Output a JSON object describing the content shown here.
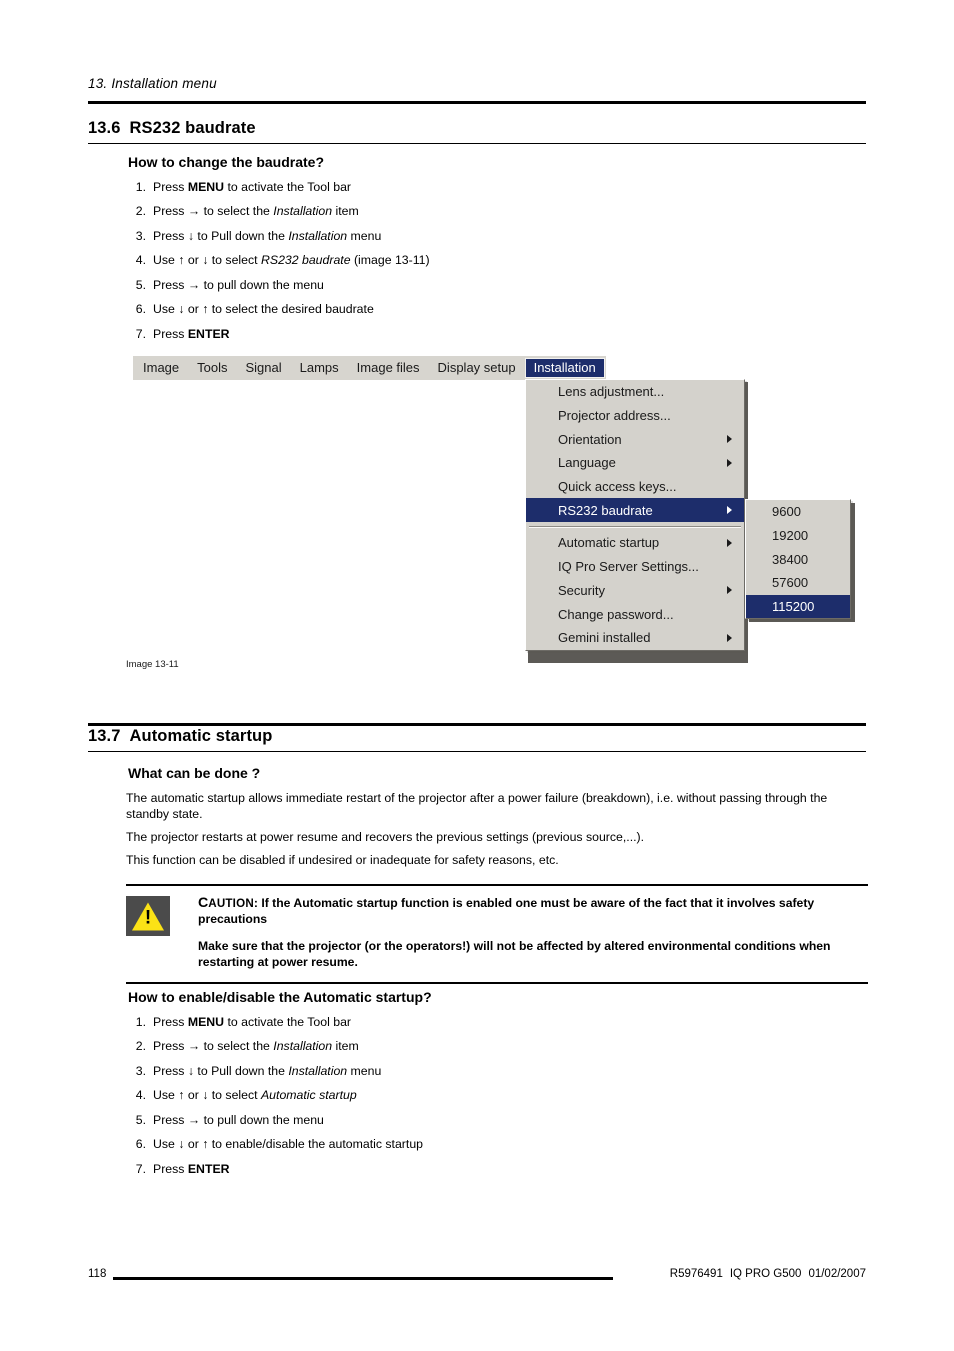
{
  "header": {
    "running_head": "13.  Installation menu"
  },
  "section_rs232": {
    "number": "13.6",
    "title": "RS232 baudrate",
    "subheading": "How to change the baudrate?",
    "steps": [
      {
        "n": "1.",
        "pre": "Press ",
        "bold": "MENU",
        "post": " to activate the Tool bar",
        "italic": "",
        "tail": ""
      },
      {
        "n": "2.",
        "pre": "Press → to select the ",
        "bold": "",
        "italic": "Installation",
        "post": " item",
        "tail": ""
      },
      {
        "n": "3.",
        "pre": "Press ↓ to Pull down the ",
        "bold": "",
        "italic": "Installation",
        "post": " menu",
        "tail": ""
      },
      {
        "n": "4.",
        "pre": "Use ↑ or ↓ to select ",
        "bold": "",
        "italic": "RS232 baudrate",
        "post": " (image 13-11)",
        "tail": ""
      },
      {
        "n": "5.",
        "pre": "Press → to pull down the menu",
        "bold": "",
        "italic": "",
        "post": "",
        "tail": ""
      },
      {
        "n": "6.",
        "pre": "Use ↓ or ↑ to select the desired baudrate",
        "bold": "",
        "italic": "",
        "post": "",
        "tail": ""
      },
      {
        "n": "7.",
        "pre": "Press ",
        "bold": "ENTER",
        "italic": "",
        "post": "",
        "tail": ""
      }
    ],
    "figure_caption": "Image 13-11"
  },
  "projector_ui": {
    "menubar": [
      {
        "label": "Image",
        "active": false
      },
      {
        "label": "Tools",
        "active": false
      },
      {
        "label": "Signal",
        "active": false
      },
      {
        "label": "Lamps",
        "active": false
      },
      {
        "label": "Image files",
        "active": false
      },
      {
        "label": "Display setup",
        "active": false
      },
      {
        "label": "Installation",
        "active": true
      }
    ],
    "installation_menu": [
      {
        "label": "Lens adjustment...",
        "submenu": false,
        "selected": false,
        "separator_after": false
      },
      {
        "label": "Projector address...",
        "submenu": false,
        "selected": false,
        "separator_after": false
      },
      {
        "label": "Orientation",
        "submenu": true,
        "selected": false,
        "separator_after": false
      },
      {
        "label": "Language",
        "submenu": true,
        "selected": false,
        "separator_after": false
      },
      {
        "label": "Quick access keys...",
        "submenu": false,
        "selected": false,
        "separator_after": false
      },
      {
        "label": "RS232 baudrate",
        "submenu": true,
        "selected": true,
        "separator_after": true
      },
      {
        "label": "Automatic startup",
        "submenu": true,
        "selected": false,
        "separator_after": false
      },
      {
        "label": "IQ Pro Server Settings...",
        "submenu": false,
        "selected": false,
        "separator_after": false
      },
      {
        "label": "Security",
        "submenu": true,
        "selected": false,
        "separator_after": false
      },
      {
        "label": "Change password...",
        "submenu": false,
        "selected": false,
        "separator_after": false
      },
      {
        "label": "Gemini installed",
        "submenu": true,
        "selected": false,
        "separator_after": false
      }
    ],
    "baudrate_submenu": [
      {
        "label": "9600",
        "selected": false
      },
      {
        "label": "19200",
        "selected": false
      },
      {
        "label": "38400",
        "selected": false
      },
      {
        "label": "57600",
        "selected": false
      },
      {
        "label": "115200",
        "selected": true
      }
    ],
    "colors": {
      "menu_face": "#d4d2cc",
      "menu_highlight": "#1d2d6b",
      "menu_highlight_text": "#ffffff"
    }
  },
  "section_autostart": {
    "number": "13.7",
    "title": "Automatic startup",
    "subheading": "What can be done ?",
    "paragraphs": [
      "The automatic startup allows immediate restart of the projector after a power failure (breakdown), i.e. without passing through the standby state.",
      "The projector restarts at power resume and recovers the previous settings (previous source,...).",
      "This function can be disabled if undesired or inadequate for safety reasons, etc."
    ],
    "caution": {
      "label_first": "C",
      "label_rest": "AUTION",
      "label_colon": ":",
      "text1": "If the Automatic startup function is enabled one must be aware of the fact that it involves safety precautions",
      "text2": "Make sure that the projector (or the operators!) will not be affected by altered environmental conditions when restarting at power resume."
    },
    "subheading2": "How to enable/disable the Automatic startup?",
    "steps": [
      {
        "n": "1.",
        "pre": "Press ",
        "bold": "MENU",
        "italic": "",
        "post": " to activate the Tool bar"
      },
      {
        "n": "2.",
        "pre": "Press → to select the ",
        "bold": "",
        "italic": "Installation",
        "post": " item"
      },
      {
        "n": "3.",
        "pre": "Press ↓ to Pull down the ",
        "bold": "",
        "italic": "Installation",
        "post": " menu"
      },
      {
        "n": "4.",
        "pre": "Use ↑ or ↓ to select ",
        "bold": "",
        "italic": "Automatic startup",
        "post": ""
      },
      {
        "n": "5.",
        "pre": "Press → to pull down the menu",
        "bold": "",
        "italic": "",
        "post": ""
      },
      {
        "n": "6.",
        "pre": "Use ↓ or ↑ to enable/disable the automatic startup",
        "bold": "",
        "italic": "",
        "post": ""
      },
      {
        "n": "7.",
        "pre": "Press ",
        "bold": "ENTER",
        "italic": "",
        "post": ""
      }
    ]
  },
  "footer": {
    "page_number": "118",
    "part_number": "R5976491",
    "product": "IQ PRO G500",
    "date": "01/02/2007"
  }
}
